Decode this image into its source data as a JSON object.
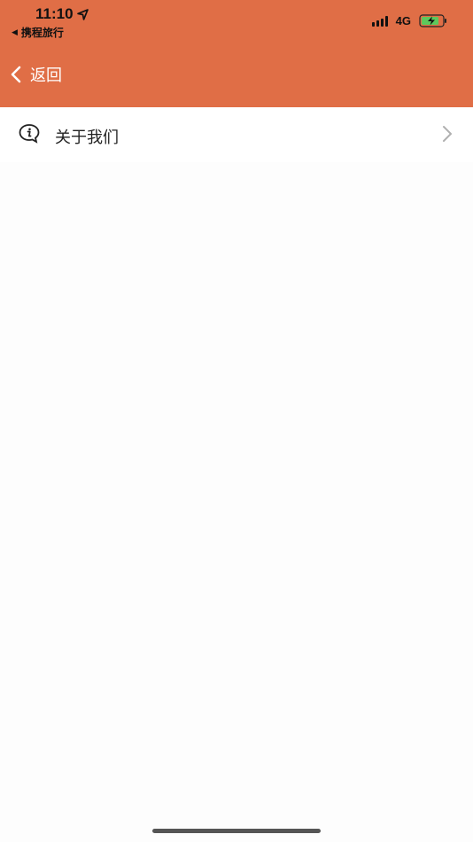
{
  "status_bar": {
    "time": "11:10",
    "back_app_label": "携程旅行",
    "network": "4G",
    "icons": [
      "location-arrow-icon",
      "signal-icon",
      "battery-charging-icon"
    ]
  },
  "nav": {
    "back_label": "返回",
    "back_icon": "chevron-left-icon"
  },
  "menu": {
    "items": [
      {
        "label": "关于我们",
        "icon": "info-bubble-icon",
        "trailing_icon": "chevron-right-icon"
      }
    ]
  },
  "colors": {
    "header_bg": "#e06e46",
    "page_bg": "#fdfdfd",
    "battery_fill": "#5cc85c"
  }
}
